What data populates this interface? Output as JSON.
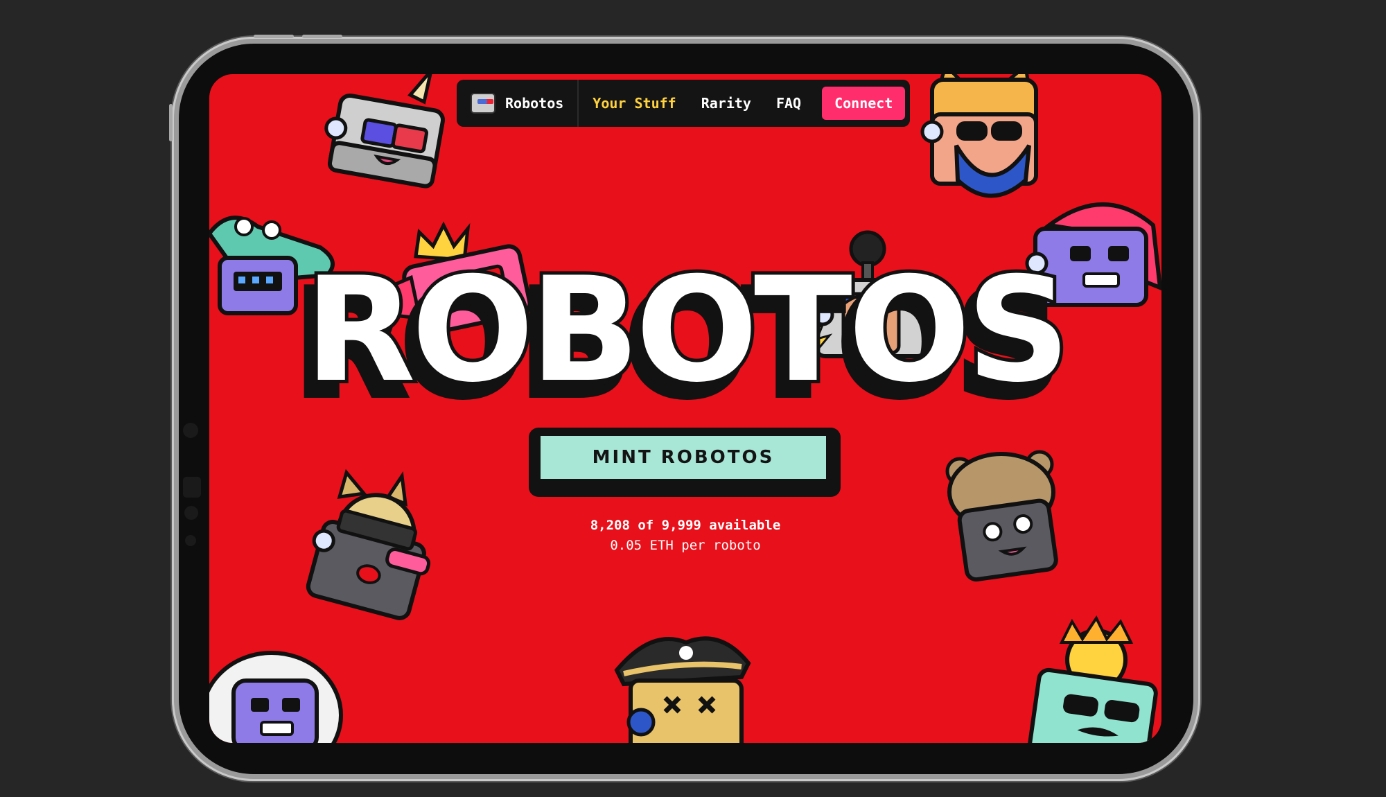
{
  "nav": {
    "brand": "Robotos",
    "links": [
      "Your Stuff",
      "Rarity",
      "FAQ"
    ],
    "connect": "Connect"
  },
  "hero": {
    "title": "ROBOTOS",
    "mint_button": "MINT ROBOTOS",
    "availability": "8,208 of 9,999 available",
    "price": "0.05 ETH per roboto"
  },
  "colors": {
    "background": "#e8101a",
    "nav_bg": "#141414",
    "active_link": "#ffd23f",
    "connect_button": "#ff2d6b",
    "mint_button": "#a8e6d6"
  },
  "robots": [
    "unicorn-3d-glasses-robot",
    "cat-sunglasses-beard-robot",
    "crocodile-robot",
    "crown-robot",
    "antenna-robot",
    "pink-hair-robot",
    "shiba-robot",
    "bear-robot",
    "astronaut-robot",
    "pirate-robot",
    "sunny-robot"
  ]
}
